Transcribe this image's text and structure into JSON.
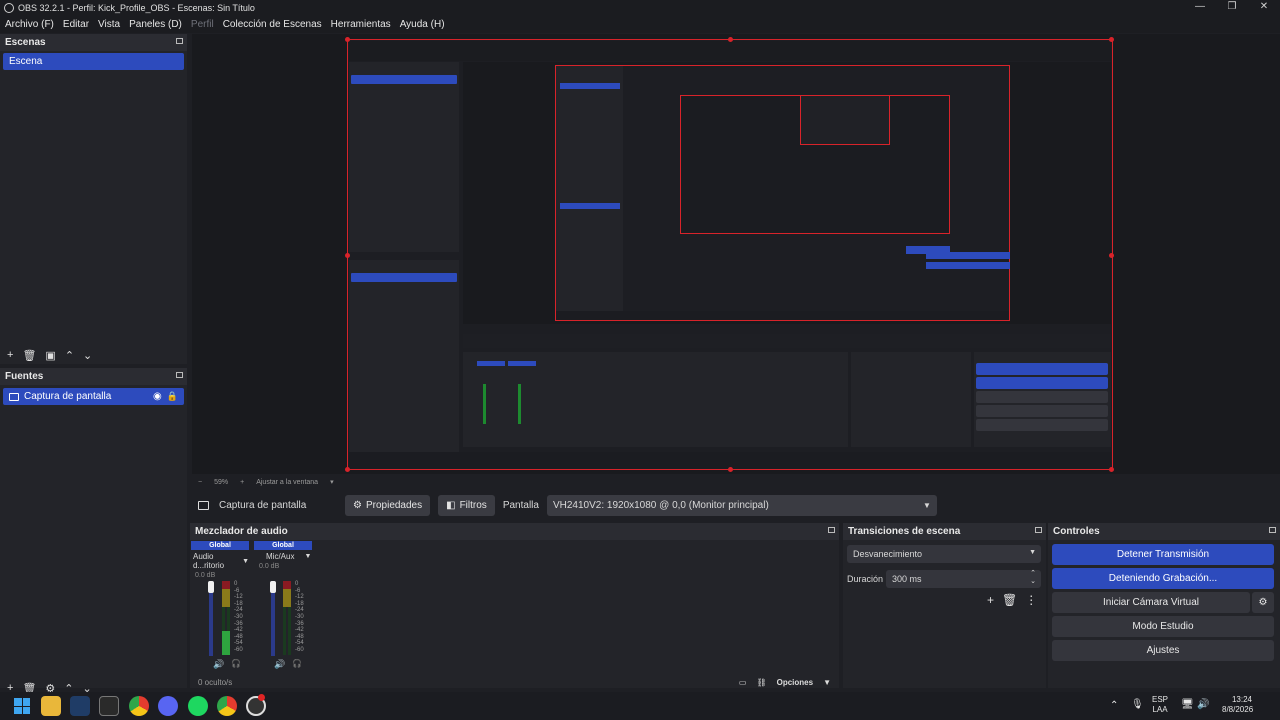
{
  "titlebar": {
    "title": "OBS 32.2.1 - Perfil: Kick_Profile_OBS - Escenas: Sin Título",
    "min": "—",
    "max": "❐",
    "close": "✕"
  },
  "menu": [
    "Archivo (F)",
    "Editar",
    "Vista",
    "Paneles (D)",
    "Perfil",
    "Colección de Escenas",
    "Herramientas",
    "Ayuda (H)"
  ],
  "scenes": {
    "title": "Escenas",
    "items": [
      "Escena"
    ]
  },
  "sources": {
    "title": "Fuentes",
    "items": [
      {
        "label": "Captura de pantalla"
      }
    ]
  },
  "preview": {
    "zoom": "59%",
    "fit": "Ajustar a la ventana"
  },
  "sourcebar": {
    "source_name": "Captura de pantalla",
    "properties": "Propiedades",
    "filters": "Filtros",
    "display_label": "Pantalla",
    "display_value": "VH2410V2: 1920x1080 @ 0,0 (Monitor principal)"
  },
  "mixer": {
    "title": "Mezclador de audio",
    "channels": [
      {
        "scope": "Global",
        "name": "Audio d...ritorio",
        "db": "0.0 dB"
      },
      {
        "scope": "Global",
        "name": "Mic/Aux",
        "db": "0.0 dB"
      }
    ],
    "scale": [
      "0",
      "-6",
      "-12",
      "-18",
      "-24",
      "-30",
      "-36",
      "-42",
      "-48",
      "-54",
      "-60"
    ],
    "footer_hidden": "0 oculto/s",
    "options": "Opciones"
  },
  "transitions": {
    "title": "Transiciones de escena",
    "selected": "Desvanecimiento",
    "duration_label": "Duración",
    "duration_value": "300 ms"
  },
  "controls": {
    "title": "Controles",
    "stop_stream": "Detener Transmisión",
    "stopping_recording": "Deteniendo Grabación...",
    "virtual_cam": "Iniciar Cámara Virtual",
    "studio_mode": "Modo Estudio",
    "settings": "Ajustes"
  },
  "taskbar": {
    "lang_top": "ESP",
    "lang_bottom": "LAA",
    "time": "13:24",
    "date": "8/8/2026"
  },
  "colors": {
    "accent": "#2d4bbd",
    "red_outline": "#d8232a",
    "meter_green": "#1d8a2f"
  }
}
